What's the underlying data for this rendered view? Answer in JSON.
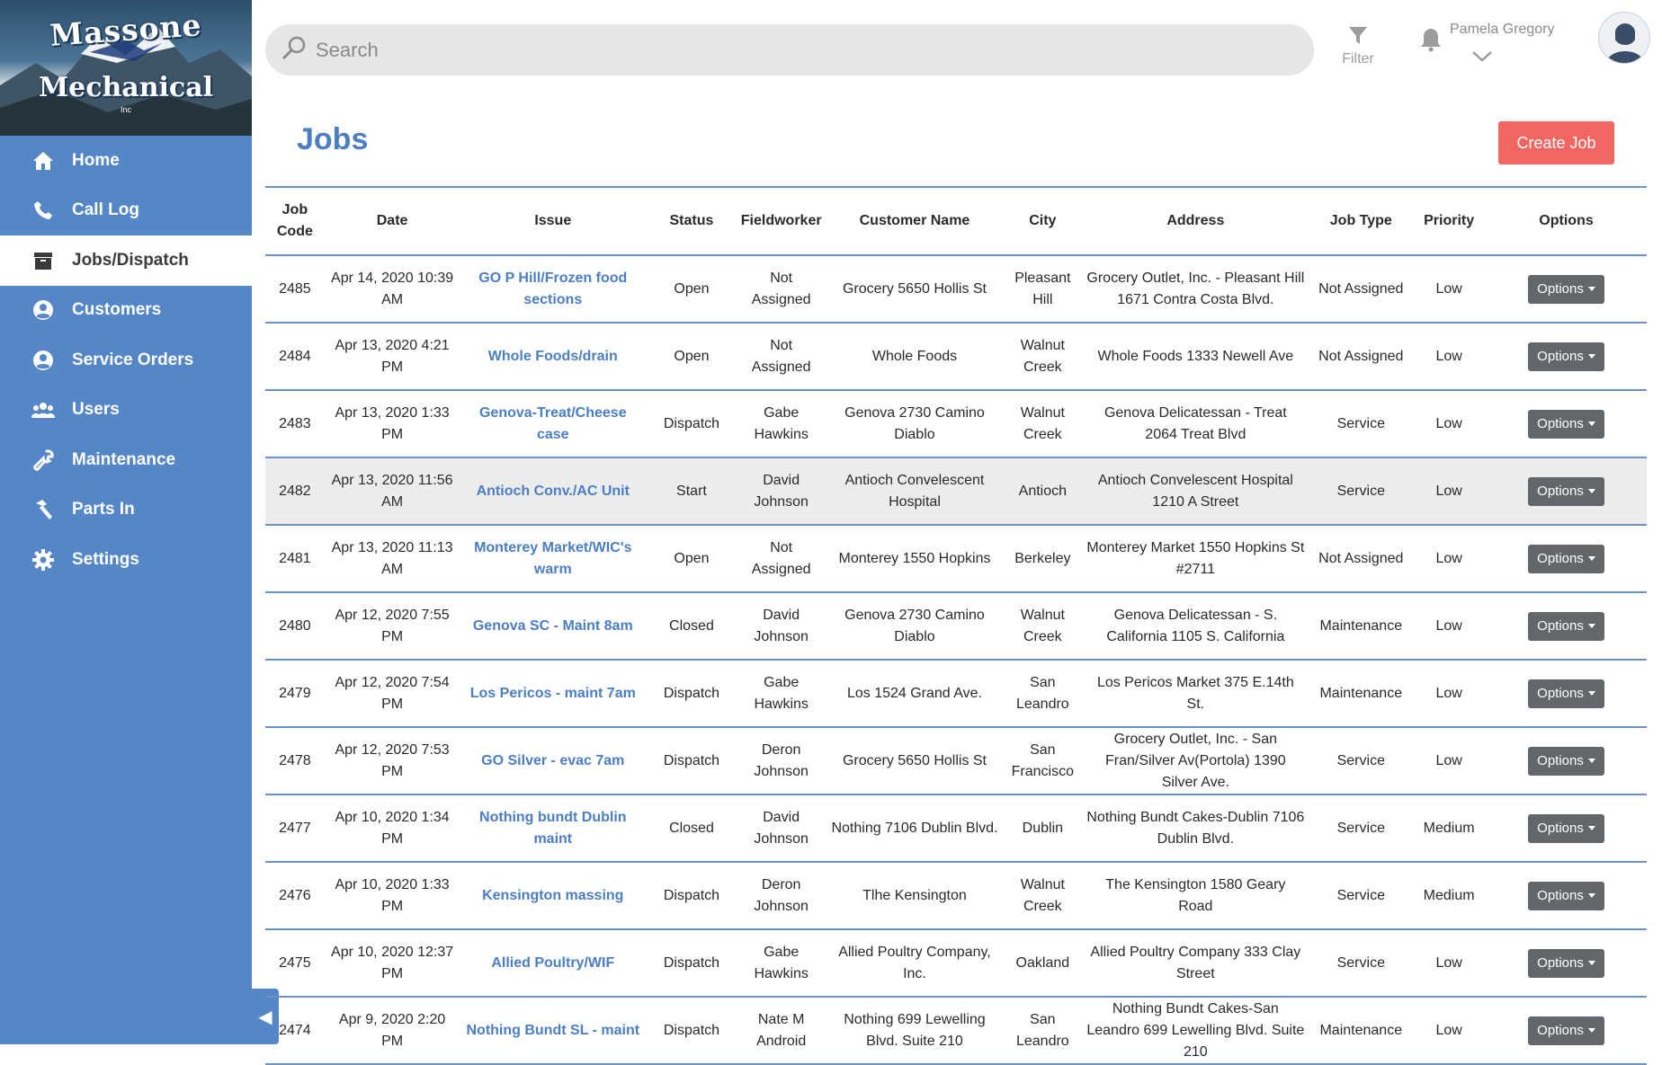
{
  "brand": {
    "line1": "Massone",
    "line2": "Mechanical",
    "line3": "Inc"
  },
  "sidebar": {
    "items": [
      {
        "label": "Home",
        "icon": "home-icon",
        "active": false
      },
      {
        "label": "Call Log",
        "icon": "phone-icon",
        "active": false
      },
      {
        "label": "Jobs/Dispatch",
        "icon": "archive-box-icon",
        "active": true
      },
      {
        "label": "Customers",
        "icon": "user-circle-icon",
        "active": false
      },
      {
        "label": "Service Orders",
        "icon": "user-circle-icon",
        "active": false
      },
      {
        "label": "Users",
        "icon": "users-group-icon",
        "active": false
      },
      {
        "label": "Maintenance",
        "icon": "wrench-icon",
        "active": false
      },
      {
        "label": "Parts In",
        "icon": "hammer-icon",
        "active": false
      },
      {
        "label": "Settings",
        "icon": "gear-icon",
        "active": false
      }
    ]
  },
  "topbar": {
    "search_placeholder": "Search",
    "filter_label": "Filter",
    "user_name": "Pamela Gregory"
  },
  "page": {
    "title": "Jobs",
    "create_label": "Create Job"
  },
  "table": {
    "headers": [
      "Job Code",
      "Date",
      "Issue",
      "Status",
      "Fieldworker",
      "Customer Name",
      "City",
      "Address",
      "Job Type",
      "Priority",
      "Options"
    ],
    "options_label": "Options",
    "rows": [
      {
        "code": "2485",
        "date": "Apr 14, 2020 10:39 AM",
        "issue": "GO P Hill/Frozen food sections",
        "status": "Open",
        "fieldworker": "Not Assigned",
        "customer": "Grocery 5650 Hollis St",
        "city": "Pleasant Hill",
        "address": "Grocery Outlet, Inc. - Pleasant Hill 1671 Contra Costa Blvd.",
        "type": "Not Assigned",
        "priority": "Low"
      },
      {
        "code": "2484",
        "date": "Apr 13, 2020 4:21 PM",
        "issue": "Whole Foods/drain",
        "status": "Open",
        "fieldworker": "Not Assigned",
        "customer": "Whole Foods",
        "city": "Walnut Creek",
        "address": "Whole Foods 1333 Newell Ave",
        "type": "Not Assigned",
        "priority": "Low"
      },
      {
        "code": "2483",
        "date": "Apr 13, 2020 1:33 PM",
        "issue": "Genova-Treat/Cheese case",
        "status": "Dispatch",
        "fieldworker": "Gabe Hawkins",
        "customer": "Genova 2730 Camino Diablo",
        "city": "Walnut Creek",
        "address": "Genova Delicatessan - Treat 2064 Treat Blvd",
        "type": "Service",
        "priority": "Low"
      },
      {
        "code": "2482",
        "date": "Apr 13, 2020 11:56 AM",
        "issue": "Antioch Conv./AC Unit",
        "status": "Start",
        "fieldworker": "David Johnson",
        "customer": "Antioch Convelescent Hospital",
        "city": "Antioch",
        "address": "Antioch Convelescent Hospital 1210 A Street",
        "type": "Service",
        "priority": "Low",
        "highlight": true
      },
      {
        "code": "2481",
        "date": "Apr 13, 2020 11:13 AM",
        "issue": "Monterey Market/WIC's warm",
        "status": "Open",
        "fieldworker": "Not Assigned",
        "customer": "Monterey 1550 Hopkins",
        "city": "Berkeley",
        "address": "Monterey Market 1550 Hopkins St #2711",
        "type": "Not Assigned",
        "priority": "Low"
      },
      {
        "code": "2480",
        "date": "Apr 12, 2020 7:55 PM",
        "issue": "Genova SC - Maint 8am",
        "status": "Closed",
        "fieldworker": "David Johnson",
        "customer": "Genova 2730 Camino Diablo",
        "city": "Walnut Creek",
        "address": "Genova Delicatessan - S. California 1105 S. California",
        "type": "Maintenance",
        "priority": "Low"
      },
      {
        "code": "2479",
        "date": "Apr 12, 2020 7:54 PM",
        "issue": "Los Pericos - maint 7am",
        "status": "Dispatch",
        "fieldworker": "Gabe Hawkins",
        "customer": "Los 1524 Grand Ave.",
        "city": "San Leandro",
        "address": "Los Pericos Market 375 E.14th St.",
        "type": "Maintenance",
        "priority": "Low"
      },
      {
        "code": "2478",
        "date": "Apr 12, 2020 7:53 PM",
        "issue": "GO Silver - evac 7am",
        "status": "Dispatch",
        "fieldworker": "Deron Johnson",
        "customer": "Grocery 5650 Hollis St",
        "city": "San Francisco",
        "address": "Grocery Outlet, Inc. - San Fran/Silver Av(Portola) 1390 Silver Ave.",
        "type": "Service",
        "priority": "Low"
      },
      {
        "code": "2477",
        "date": "Apr 10, 2020 1:34 PM",
        "issue": "Nothing bundt Dublin maint",
        "status": "Closed",
        "fieldworker": "David Johnson",
        "customer": "Nothing 7106 Dublin Blvd.",
        "city": "Dublin",
        "address": "Nothing Bundt Cakes-Dublin 7106 Dublin Blvd.",
        "type": "Service",
        "priority": "Medium"
      },
      {
        "code": "2476",
        "date": "Apr 10, 2020 1:33 PM",
        "issue": "Kensington massing",
        "status": "Dispatch",
        "fieldworker": "Deron Johnson",
        "customer": "Tlhe Kensington",
        "city": "Walnut Creek",
        "address": "The Kensington 1580 Geary Road",
        "type": "Service",
        "priority": "Medium"
      },
      {
        "code": "2475",
        "date": "Apr 10, 2020 12:37 PM",
        "issue": "Allied Poultry/WIF",
        "status": "Dispatch",
        "fieldworker": "Gabe Hawkins",
        "customer": "Allied Poultry Company, Inc.",
        "city": "Oakland",
        "address": "Allied Poultry Company 333 Clay Street",
        "type": "Service",
        "priority": "Low"
      },
      {
        "code": "2474",
        "date": "Apr 9, 2020 2:20 PM",
        "issue": "Nothing Bundt SL - maint",
        "status": "Dispatch",
        "fieldworker": "Nate M Android",
        "customer": "Nothing 699 Lewelling Blvd. Suite 210",
        "city": "San Leandro",
        "address": "Nothing Bundt Cakes-San Leandro 699 Lewelling Blvd. Suite 210",
        "type": "Maintenance",
        "priority": "Low"
      }
    ]
  },
  "colors": {
    "sidebar": "#5486c8",
    "accent": "#4b7ec2",
    "create_button": "#f26662",
    "options_button": "#63676b"
  }
}
